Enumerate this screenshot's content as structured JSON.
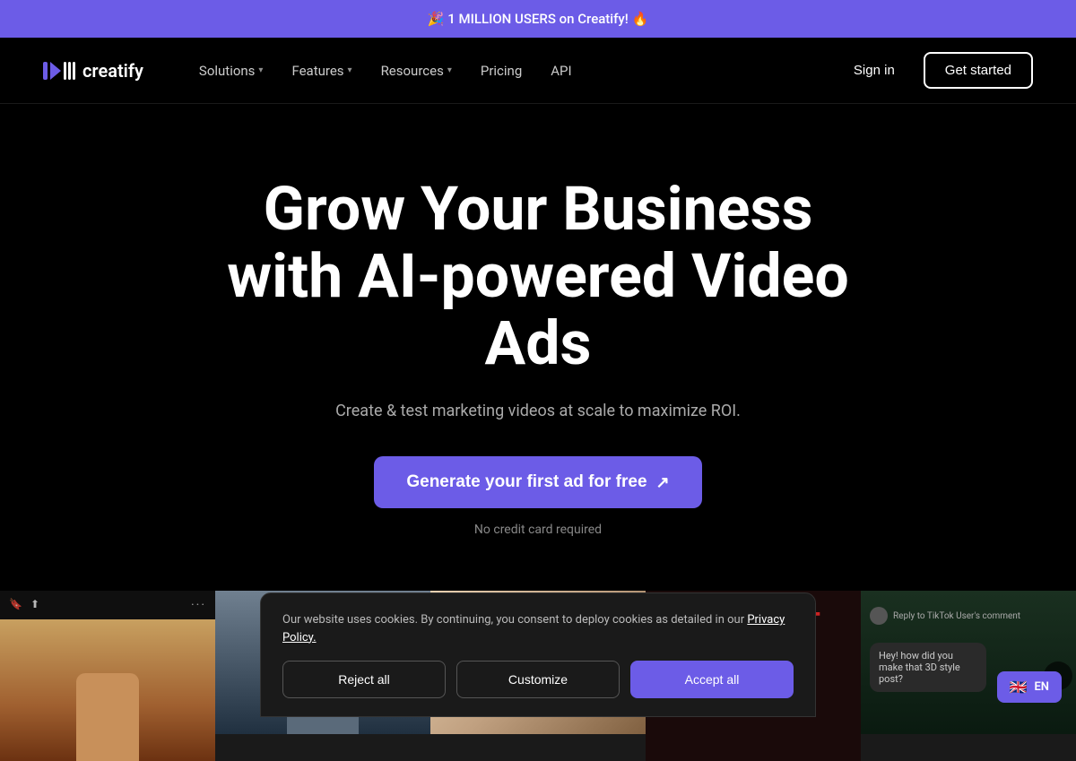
{
  "banner": {
    "text": "🎉 1 MILLION USERS on Creatify! 🔥"
  },
  "navbar": {
    "logo_text": "creatify",
    "solutions_label": "Solutions",
    "features_label": "Features",
    "resources_label": "Resources",
    "pricing_label": "Pricing",
    "api_label": "API",
    "sign_in_label": "Sign in",
    "get_started_label": "Get started"
  },
  "hero": {
    "title_line1": "Grow Your Business",
    "title_line2": "with AI-powered Video Ads",
    "subtitle": "Create & test marketing videos at scale to maximize ROI.",
    "cta_label": "Generate your first ad for free",
    "no_credit": "No credit card required"
  },
  "cookie": {
    "text": "Our website uses cookies. By continuing, you consent to deploy cookies as detailed in our",
    "policy_link": "Privacy Policy.",
    "reject_label": "Reject all",
    "customize_label": "Customize",
    "accept_label": "Accept all"
  },
  "language": {
    "flag": "🇬🇧",
    "code": "EN"
  },
  "video_nav": {
    "prev": "‹",
    "next": "›"
  }
}
